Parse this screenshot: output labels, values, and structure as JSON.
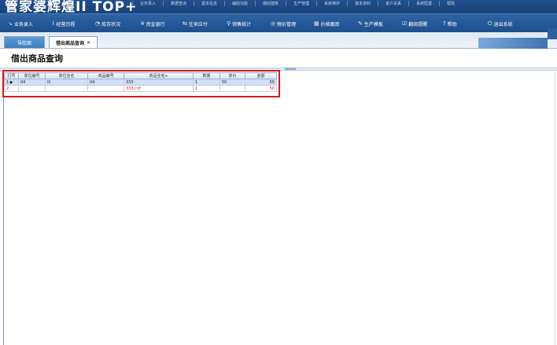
{
  "app": {
    "logo_text": "管家婆辉煌II TOP+"
  },
  "top_menu": [
    "业务录入",
    "数据查询",
    "基本信息",
    "辅助功能",
    "期初建账",
    "生产管理",
    "系统维护",
    "基本资料",
    "客户关系",
    "系统配置",
    "帮助"
  ],
  "nav": [
    {
      "icon": "↘",
      "label": "业务录入"
    },
    {
      "icon": "⌇",
      "label": "经营历程"
    },
    {
      "icon": "◔",
      "label": "库存状况"
    },
    {
      "icon": "¥",
      "label": "资金银行"
    },
    {
      "icon": "⇆",
      "label": "往来应付"
    },
    {
      "icon": "⚲",
      "label": "销售统计"
    },
    {
      "icon": "◎",
      "label": "物价管理"
    },
    {
      "icon": "▦",
      "label": "价格跟踪"
    },
    {
      "icon": "✎",
      "label": "生产模板"
    },
    {
      "icon": "☑",
      "label": "翻阅提醒"
    },
    {
      "icon": "?",
      "label": "帮助"
    },
    {
      "icon": "⏻",
      "label": "退出系统"
    }
  ],
  "tabs": {
    "nav_label": "导航图",
    "active_label": "借出商品查询",
    "close_glyph": "✕"
  },
  "page_title": "借出商品查询",
  "table": {
    "headers": [
      "行号",
      "单位编号",
      "单位全名",
      "商品编号",
      "商品全名∧",
      "数量",
      "单价",
      "金额"
    ],
    "rows": [
      {
        "row_no": "1",
        "pointer": "▶",
        "unit_code": "04",
        "unit_name": "lll",
        "product_code": "04",
        "product_name": "333",
        "qty": "1",
        "price": "50",
        "amount": "50"
      },
      {
        "row_no": "2",
        "pointer": "",
        "unit_code": "",
        "unit_name": "",
        "product_code": "",
        "product_name": "333小计",
        "qty": "1",
        "price": "",
        "amount": "50"
      }
    ]
  },
  "colors": {
    "highlight": "#d9161f",
    "subtotal_text": "#d21c1c",
    "selected_row": "#cfe0f5"
  }
}
